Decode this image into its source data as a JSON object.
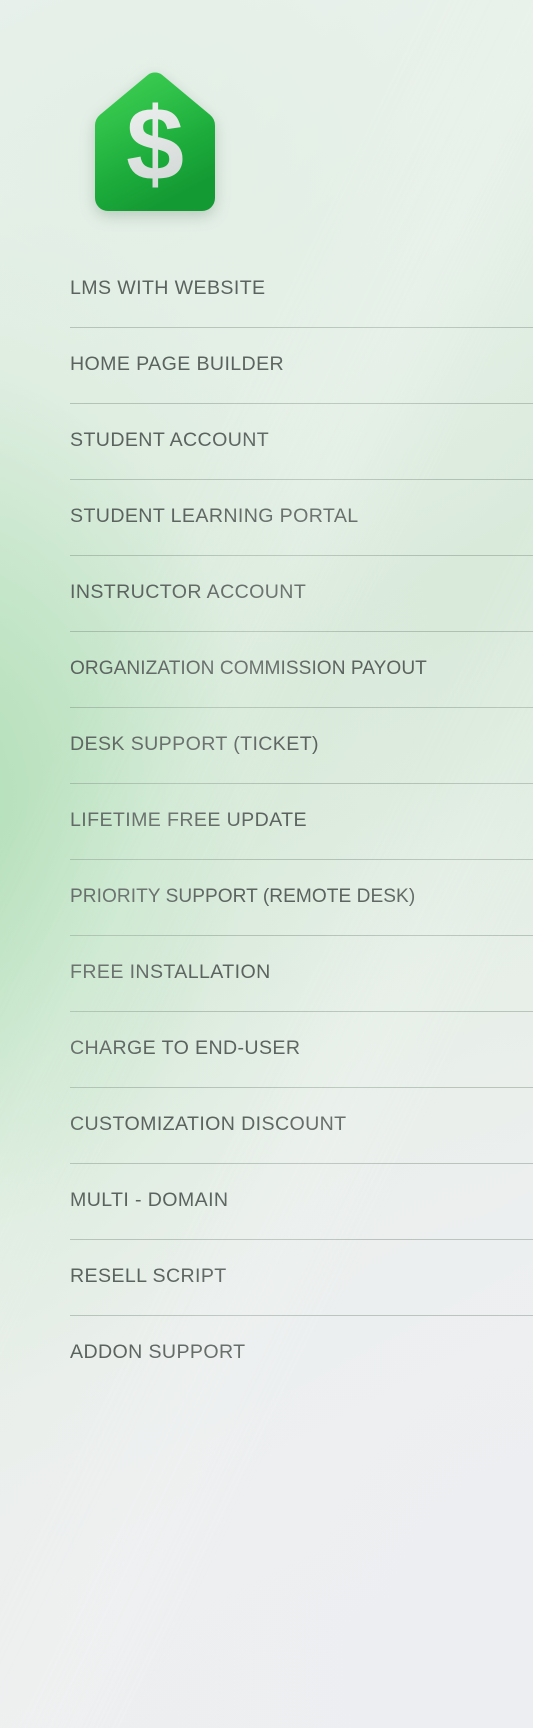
{
  "brand": {
    "logo_icon": "dollar-sign-house-badge-icon",
    "logo_symbol": "$",
    "logo_colors": {
      "green_light": "#3fcc52",
      "green_mid": "#29b843",
      "green_dark": "#139a33",
      "symbol": "#e2e6e4"
    }
  },
  "page": {
    "background_colors": {
      "top_left": "#eaf1ed",
      "mid_left_green": "#c9e5cc",
      "bottom_right_grey": "#eceef0"
    },
    "text_color": "#5b635f",
    "divider_color": "#78877d"
  },
  "features": {
    "items": [
      {
        "label": "LMS WITH WEBSITE"
      },
      {
        "label": "HOME PAGE BUILDER"
      },
      {
        "label": "STUDENT ACCOUNT"
      },
      {
        "label": "STUDENT LEARNING PORTAL"
      },
      {
        "label": "INSTRUCTOR ACCOUNT"
      },
      {
        "label": "ORGANIZATION COMMISSION PAYOUT"
      },
      {
        "label": "DESK SUPPORT (TICKET)"
      },
      {
        "label": "LIFETIME FREE UPDATE"
      },
      {
        "label": "PRIORITY SUPPORT (REMOTE DESK)"
      },
      {
        "label": "FREE INSTALLATION"
      },
      {
        "label": "CHARGE TO END-USER"
      },
      {
        "label": "CUSTOMIZATION DISCOUNT"
      },
      {
        "label": "MULTI - DOMAIN"
      },
      {
        "label": "RESELL SCRIPT"
      },
      {
        "label": "ADDON SUPPORT"
      }
    ]
  }
}
